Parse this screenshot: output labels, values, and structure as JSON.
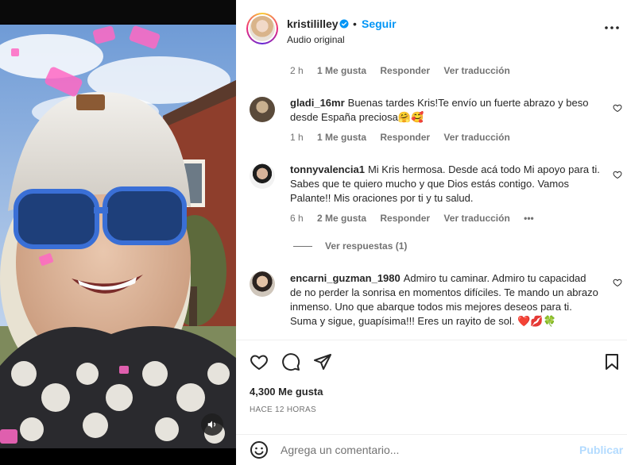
{
  "header": {
    "username": "kristililley",
    "separator": "•",
    "follow_label": "Seguir",
    "audio_label": "Audio original"
  },
  "comments": [
    {
      "username": "",
      "text": "",
      "time": "2 h",
      "likes": "1 Me gusta",
      "reply_label": "Responder",
      "translate_label": "Ver traducción"
    },
    {
      "username": "gladi_16mr",
      "text": "Buenas tardes Kris!Te envío un fuerte abrazo y beso desde España preciosa🤗🥰",
      "time": "1 h",
      "likes": "1 Me gusta",
      "reply_label": "Responder",
      "translate_label": "Ver traducción"
    },
    {
      "username": "tonnyvalencia1",
      "text": "Mi Kris hermosa. Desde acá todo Mi apoyo para ti. Sabes que te quiero mucho y que Dios estás contigo. Vamos Palante!! Mis oraciones por ti y tu salud.",
      "time": "6 h",
      "likes": "2 Me gusta",
      "reply_label": "Responder",
      "translate_label": "Ver traducción",
      "more": "•••",
      "view_replies": "Ver respuestas (1)"
    },
    {
      "username": "encarni_guzman_1980",
      "text": "Admiro tu caminar. Admiro tu capacidad de no perder la sonrisa en momentos difíciles. Te mando un abrazo inmenso. Uno que abarque todos mis mejores deseos para ti. Suma y sigue, guapísima!!! Eres un rayito de sol. ❤️💋🍀"
    }
  ],
  "post": {
    "likes_total": "4,300 Me gusta",
    "time_ago": "HACE 12 HORAS"
  },
  "comment_box": {
    "placeholder": "Agrega un comentario...",
    "publish_label": "Publicar"
  },
  "colors": {
    "accent": "#0095f6",
    "text": "#262626",
    "muted": "#737373",
    "publish_disabled": "#b3dbff",
    "verified": "#0095f6"
  },
  "icons": {
    "verified": "verified-badge-icon",
    "more": "more-options-icon",
    "like": "heart-icon",
    "comment": "comment-bubble-icon",
    "share": "paper-plane-icon",
    "save": "bookmark-icon",
    "emoji": "smiley-icon",
    "sound": "speaker-icon"
  }
}
